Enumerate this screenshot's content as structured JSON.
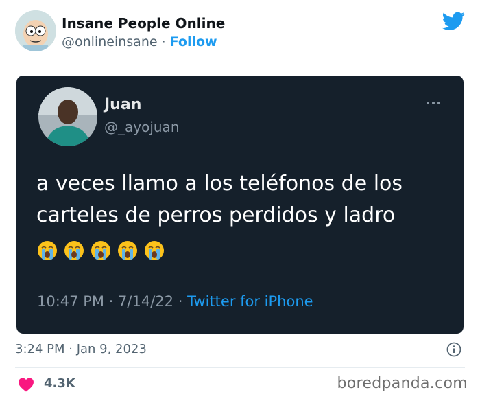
{
  "account": {
    "name": "Insane People Online",
    "handle": "@onlineinsane",
    "separator": "·",
    "follow_label": "Follow",
    "avatar_icon": "cartoon-avatar"
  },
  "embedded_tweet": {
    "name": "Juan",
    "handle": "@_ayojuan",
    "text": "a veces llamo a los teléfonos de los carteles de perros perdidos y ladro",
    "emojis": [
      "😭",
      "😭",
      "😭",
      "😭",
      "😭"
    ],
    "time": "10:47 PM",
    "date": "7/14/22",
    "separator": "·",
    "source": "Twitter for iPhone",
    "background": "#15202b"
  },
  "footer": {
    "timestamp": "3:24 PM · Jan 9, 2023",
    "likes": "4.3K",
    "watermark": "boredpanda.com"
  },
  "colors": {
    "accent": "#1d9bf0",
    "heart": "#f91880",
    "muted": "#536471"
  }
}
